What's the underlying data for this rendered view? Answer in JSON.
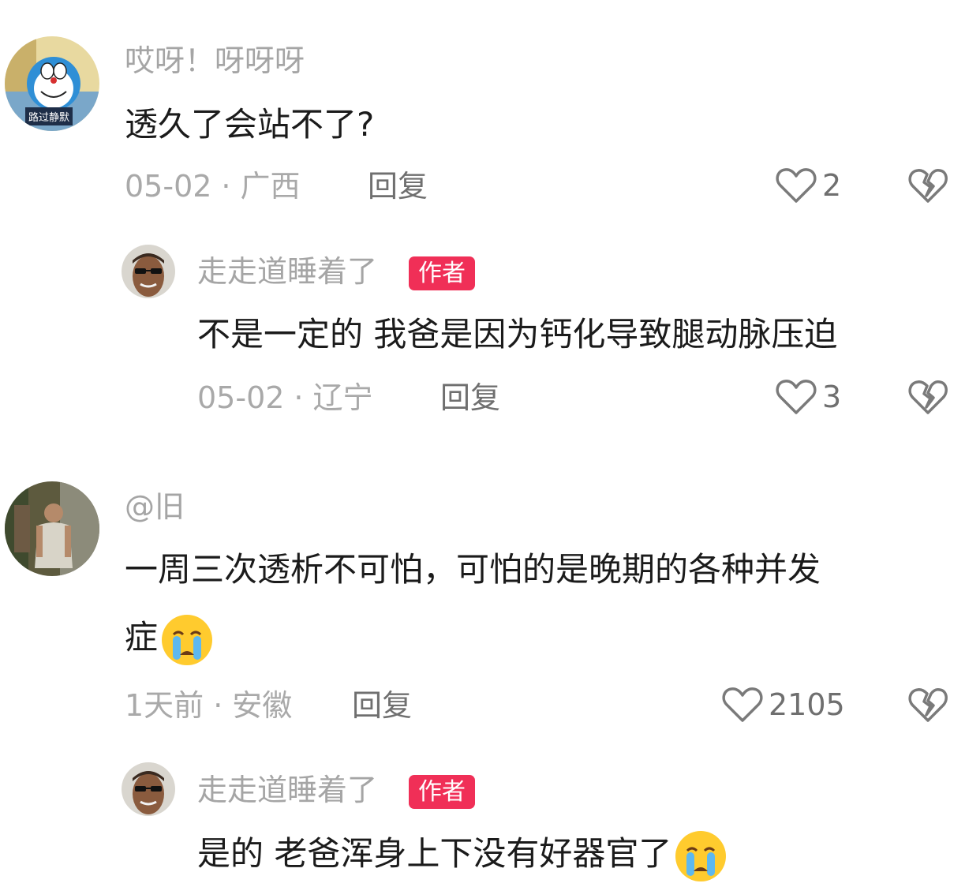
{
  "comments": [
    {
      "username": "哎呀！呀呀呀",
      "avatar_icon": "doraemon-avatar",
      "avatar_text": "路过静默",
      "text": "透久了会站不了?",
      "date": "05-02",
      "location": "广西",
      "reply_label": "回复",
      "likes": "2",
      "replies": [
        {
          "username": "走走道睡着了",
          "badge": "作者",
          "avatar_icon": "man-sunglasses-avatar",
          "text": "不是一定的 我爸是因为钙化导致腿动脉压迫",
          "date": "05-02",
          "location": "辽宁",
          "reply_label": "回复",
          "likes": "3"
        }
      ]
    },
    {
      "username": "@旧",
      "avatar_icon": "man-back-view-avatar",
      "text_line1": "一周三次透析不可怕，可怕的是晚期的各种并发",
      "text_line2": "症",
      "emoji": "crying-face-emoji",
      "date": "1天前",
      "location": "安徽",
      "reply_label": "回复",
      "likes": "2105",
      "replies": [
        {
          "username": "走走道睡着了",
          "badge": "作者",
          "avatar_icon": "man-sunglasses-avatar",
          "text": "是的 老爸浑身上下没有好器官了",
          "emoji": "crying-face-emoji"
        }
      ]
    }
  ],
  "colors": {
    "badge": "#f02f57",
    "username": "#a5a5a5",
    "text": "#1b1b1b",
    "meta": "#a9a9a9",
    "action": "#6f6f6f"
  }
}
